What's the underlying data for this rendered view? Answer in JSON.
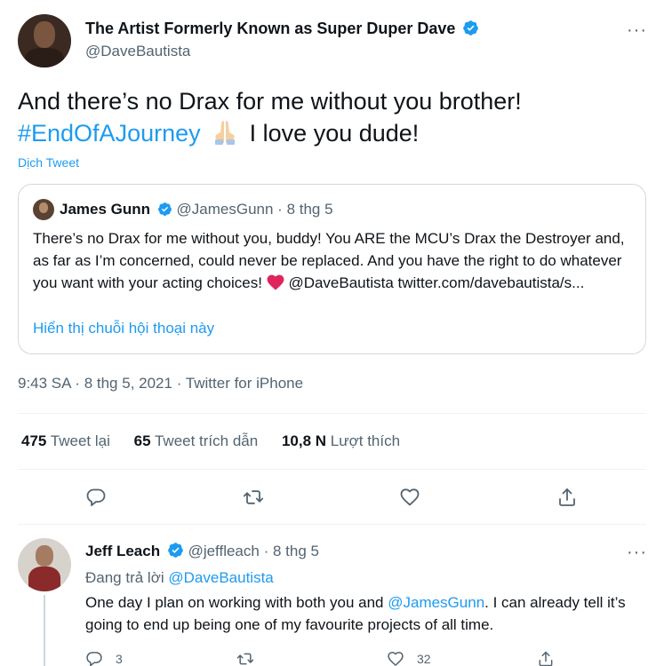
{
  "tweet": {
    "author_name": "The Artist Formerly Known as Super Duper Dave",
    "author_handle": "@DaveBautista",
    "text_line1": "And there’s no Drax for me without you brother!",
    "hashtag": "#EndOfAJourney",
    "text_line2_end": "I love you dude!",
    "translate_label": "Dịch Tweet",
    "more_label": "···",
    "time": "9:43 SA",
    "date": "8 thg 5, 2021",
    "separator": "·",
    "source": "Twitter for iPhone",
    "stats": {
      "retweets_count": "475",
      "retweets_label": "Tweet lại",
      "quotes_count": "65",
      "quotes_label": "Tweet trích dẫn",
      "likes_count": "10,8 N",
      "likes_label": "Lượt thích"
    }
  },
  "quote": {
    "author_name": "James Gunn",
    "author_handle": "@JamesGunn",
    "separator": "·",
    "date": "8 thg 5",
    "text_1": "There’s no Drax for me without you, buddy! You ARE the MCU’s Drax the Destroyer and, as far as I’m concerned, could never be replaced. And you have the right to do whatever you want with your acting choices!",
    "mention": "@DaveBautista",
    "link": "twitter.com/davebautista/s...",
    "show_thread": "Hiển thị chuỗi hội thoại này"
  },
  "reply": {
    "author_name": "Jeff Leach",
    "author_handle": "@jeffleach",
    "separator": "·",
    "date": "8 thg 5",
    "replying_label": "Đang trả lời",
    "replying_to": "@DaveBautista",
    "text_1": "One day I plan on working with both you and",
    "mention": "@JamesGunn",
    "text_2": ". I can already tell it’s going to end up being one of my favourite projects of all time.",
    "more_label": "···",
    "reply_count": "3",
    "like_count": "32"
  },
  "icons": {
    "verified": "verified-badge-icon",
    "reply": "reply-icon",
    "retweet": "retweet-icon",
    "like": "heart-icon",
    "share": "share-icon",
    "more": "more-icon"
  },
  "colors": {
    "accent": "#1d9bf0",
    "text": "#0f1419",
    "secondary": "#536471",
    "border": "#cfd9de",
    "heart_emoji": "#e0245e"
  }
}
